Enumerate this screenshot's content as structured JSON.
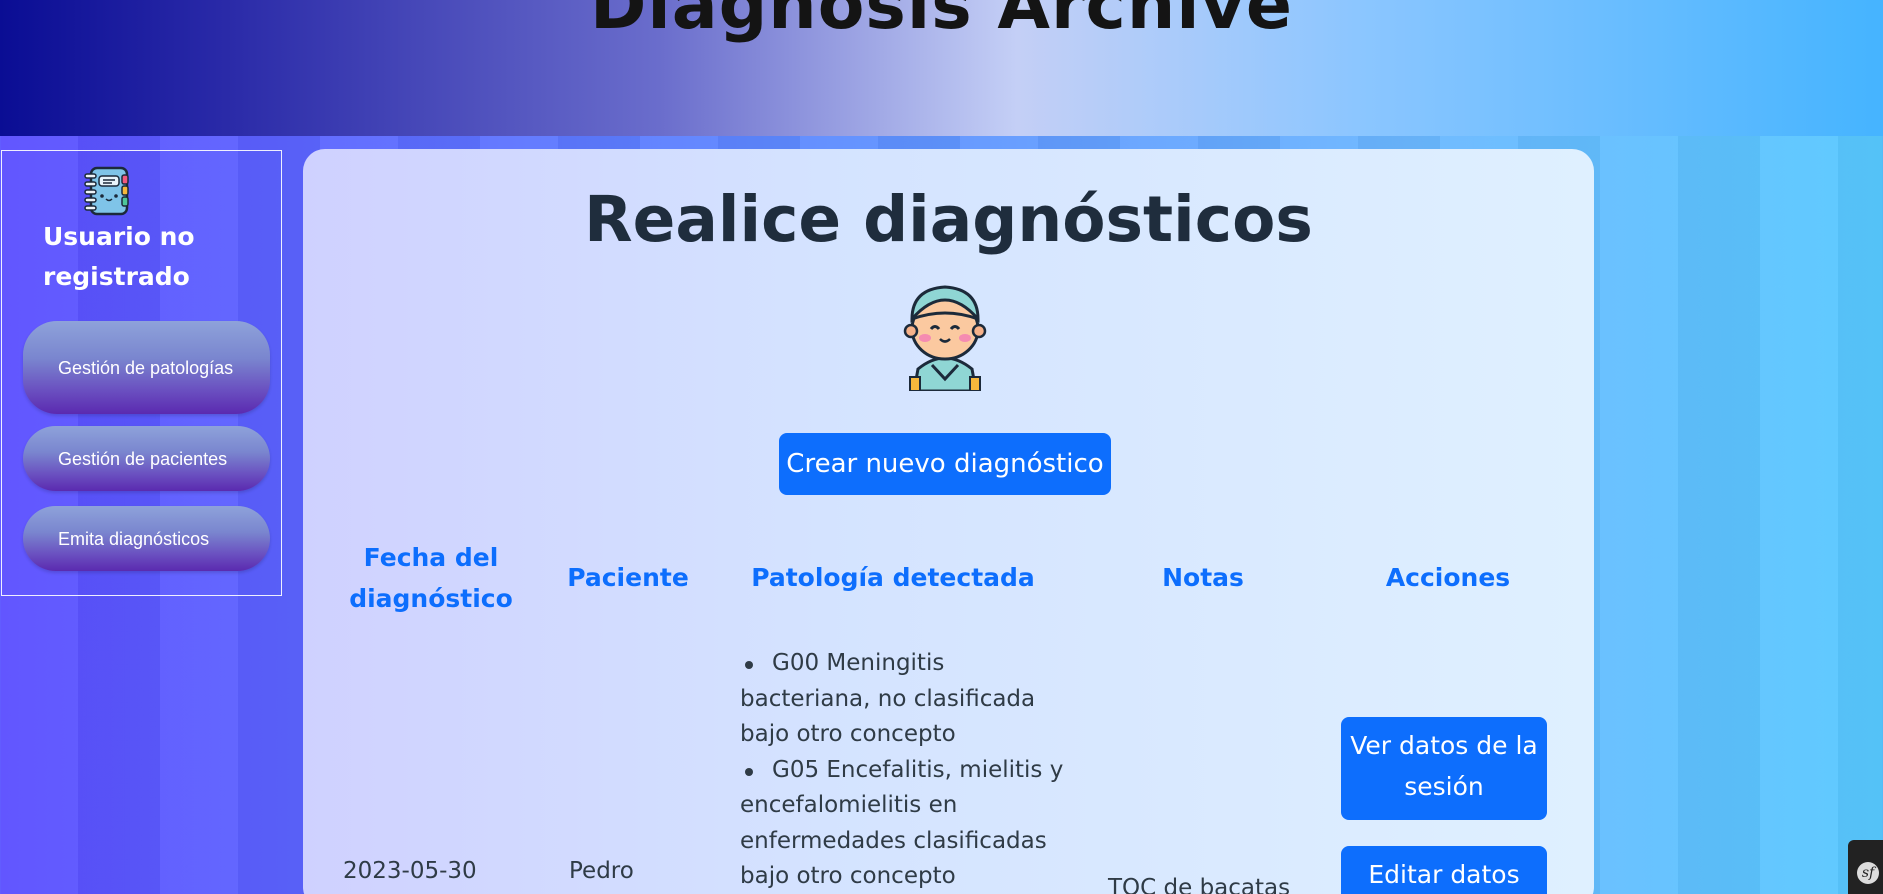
{
  "header": {
    "title": "Diagnosis Archive"
  },
  "sidebar": {
    "logo_icon": "notebook-icon",
    "user_label": "Usuario no registrado",
    "items": [
      {
        "label": "Gestión de patologías"
      },
      {
        "label": "Gestión de pacientes"
      },
      {
        "label": "Emita diagnósticos"
      }
    ]
  },
  "main": {
    "title": "Realice diagnósticos",
    "mascot_icon": "doctor-avatar-icon",
    "create_button": "Crear nuevo diagnóstico",
    "table": {
      "headers": [
        "Fecha del diagnóstico",
        "Paciente",
        "Patología detectada",
        "Notas",
        "Acciones"
      ],
      "rows": [
        {
          "date": "2023-05-30",
          "patient": "Pedro",
          "pathologies": [
            "G00 Meningitis bacteriana, no clasificada bajo otro concepto",
            "G05 Encefalitis, mielitis y encefalomielitis en enfermedades clasificadas bajo otro concepto"
          ],
          "notes": "TOC de bacatas",
          "actions": [
            "Ver datos de la sesión",
            "Editar datos"
          ]
        }
      ]
    }
  },
  "debug_toolbar": {
    "icon": "symfony-icon",
    "label": "sf"
  },
  "colors": {
    "primary": "#0d6efd",
    "header_text": "#141414",
    "title_text": "#1f2d3d"
  }
}
